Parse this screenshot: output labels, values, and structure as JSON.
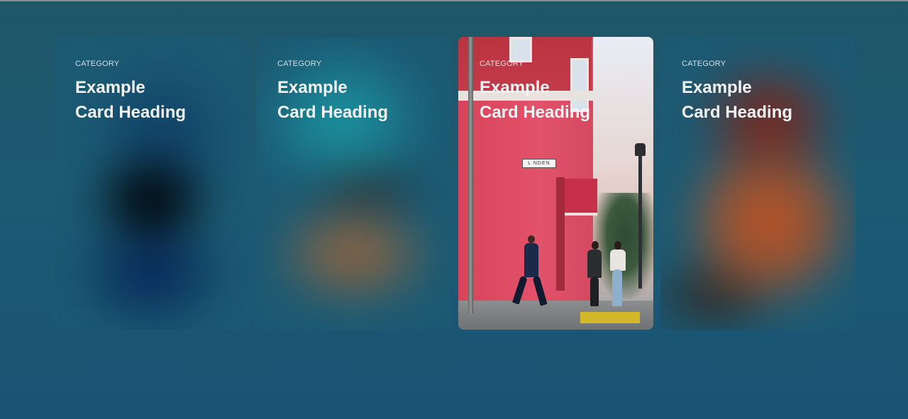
{
  "cards": [
    {
      "category": "CATEGORY",
      "heading": "Example Card Heading"
    },
    {
      "category": "CATEGORY",
      "heading": "Example Card Heading"
    },
    {
      "category": "CATEGORY",
      "heading": "Example Card Heading",
      "street_sign": "L NDEN"
    },
    {
      "category": "CATEGORY",
      "heading": "Example Card Heading"
    }
  ],
  "colors": {
    "background": "#1b5a73",
    "text": "#f2f4f6",
    "focused_building": "#e2526a"
  }
}
